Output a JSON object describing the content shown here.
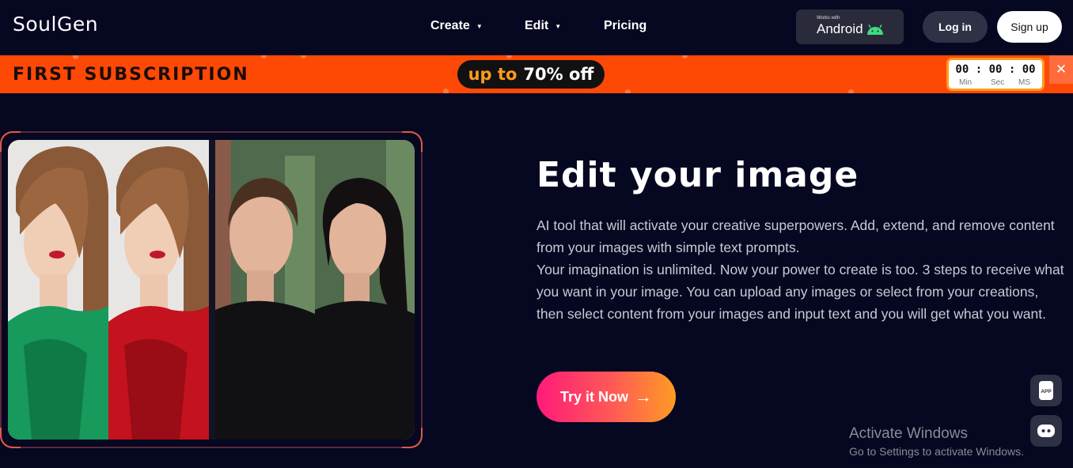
{
  "header": {
    "logo": "SoulGen",
    "nav": [
      {
        "label": "Create",
        "has_dropdown": true
      },
      {
        "label": "Edit",
        "has_dropdown": true
      },
      {
        "label": "Pricing",
        "has_dropdown": false
      }
    ],
    "android_badge": {
      "small": "Works with",
      "name": "Android",
      "icon": "android-icon"
    },
    "login_label": "Log in",
    "signup_label": "Sign up"
  },
  "promo": {
    "title": "FIRST SUBSCRIPTION",
    "discount_prefix": "up to",
    "discount_value": "70% off",
    "timer": {
      "display": "00 : 00 : 00",
      "min_label": "Min",
      "sec_label": "Sec",
      "ms_label": "MS"
    },
    "close_icon": "close-icon",
    "accent_color": "#fe4906"
  },
  "hero": {
    "image_icon": "before-after-portraits",
    "title": "Edit your image",
    "paragraph1": "AI tool that will activate your creative superpowers. Add, extend, and remove content from your images with simple text prompts.",
    "paragraph2": "Your imagination is unlimited. Now your power to create is too. 3 steps to receive what you want in your image. You can upload any images or select from your creations, then select content from your images and input text and you will get what you want.",
    "cta_label": "Try it Now",
    "cta_icon": "arrow-right-icon"
  },
  "side_buttons": [
    {
      "icon": "app-download-icon",
      "label": "APP"
    },
    {
      "icon": "chat-bot-icon"
    }
  ],
  "watermark": {
    "line1": "Activate Windows",
    "line2": "Go to Settings to activate Windows."
  }
}
